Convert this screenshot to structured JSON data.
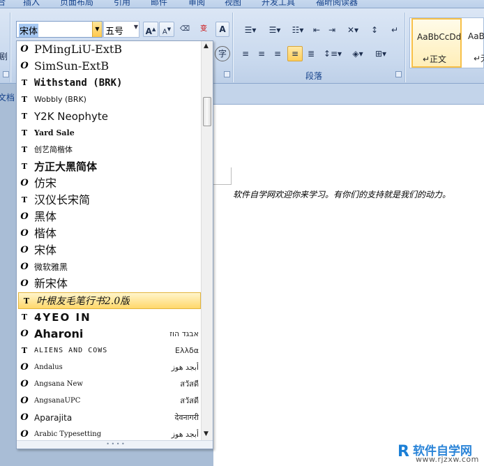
{
  "ribbon_tabs": [
    {
      "label": "插入"
    },
    {
      "label": "页面布局"
    },
    {
      "label": "引用"
    },
    {
      "label": "邮件"
    },
    {
      "label": "审阅"
    },
    {
      "label": "视图"
    },
    {
      "label": "开发工具"
    },
    {
      "label": "福昕阅读器"
    }
  ],
  "font_group": {
    "font_name": "宋体",
    "font_size": "五号",
    "grow_font": "A",
    "shrink_font": "A",
    "wen_icon": "wén",
    "char_border": "变",
    "char_shading": "A",
    "enclosed": "字"
  },
  "paragraph_group": {
    "label": "段落"
  },
  "styles": [
    {
      "sample": "AaBbCcDd",
      "name": "↵正文"
    },
    {
      "sample": "AaBb",
      "name": "↵无"
    }
  ],
  "left_strip_label": "文档",
  "document": {
    "body_text": "软件自学网欢迎你来学习。有你们的支持就是我们的动力。"
  },
  "font_list": [
    {
      "name": "PMingLiU-ExtB",
      "icon": "opentype",
      "sample": ""
    },
    {
      "name": "SimSun-ExtB",
      "icon": "opentype",
      "sample": ""
    },
    {
      "name": "Withstand (BRK)",
      "icon": "truetype",
      "sample": ""
    },
    {
      "name": "Wobbly (BRK)",
      "icon": "truetype",
      "sample": ""
    },
    {
      "name": "Y2K Neophyte",
      "icon": "truetype",
      "sample": ""
    },
    {
      "name": "Yard Sale",
      "icon": "truetype",
      "sample": ""
    },
    {
      "name": "创艺简楷体",
      "icon": "truetype",
      "sample": ""
    },
    {
      "name": "方正大黑简体",
      "icon": "truetype",
      "sample": ""
    },
    {
      "name": "仿宋",
      "icon": "opentype",
      "sample": ""
    },
    {
      "name": "汉仪长宋简",
      "icon": "truetype",
      "sample": ""
    },
    {
      "name": "黑体",
      "icon": "opentype",
      "sample": ""
    },
    {
      "name": "楷体",
      "icon": "opentype",
      "sample": ""
    },
    {
      "name": "宋体",
      "icon": "opentype",
      "sample": ""
    },
    {
      "name": "微软雅黑",
      "icon": "opentype",
      "sample": ""
    },
    {
      "name": "新宋体",
      "icon": "opentype",
      "sample": ""
    },
    {
      "name": "叶根友毛笔行书2.0版",
      "icon": "truetype",
      "sample": ""
    },
    {
      "name": "4YEO IN",
      "icon": "truetype",
      "sample": ""
    },
    {
      "name": "Aharoni",
      "icon": "opentype",
      "sample": "אבגד הוז"
    },
    {
      "name": "ALIENS AND COWS",
      "icon": "truetype",
      "sample": "Ελλδα"
    },
    {
      "name": "Andalus",
      "icon": "opentype",
      "sample": "أبجد هوز"
    },
    {
      "name": "Angsana New",
      "icon": "opentype",
      "sample": "สวัสดี"
    },
    {
      "name": "AngsanaUPC",
      "icon": "opentype",
      "sample": "สวัสดี"
    },
    {
      "name": "Aparajita",
      "icon": "opentype",
      "sample": "देवनागरी"
    },
    {
      "name": "Arabic Typesetting",
      "icon": "opentype",
      "sample": "أبجد هوز"
    }
  ],
  "highlighted_font_index": 15,
  "watermark": {
    "logo_letter": "R",
    "brand": "软件自学网",
    "url": "www.rjzxw.com"
  }
}
